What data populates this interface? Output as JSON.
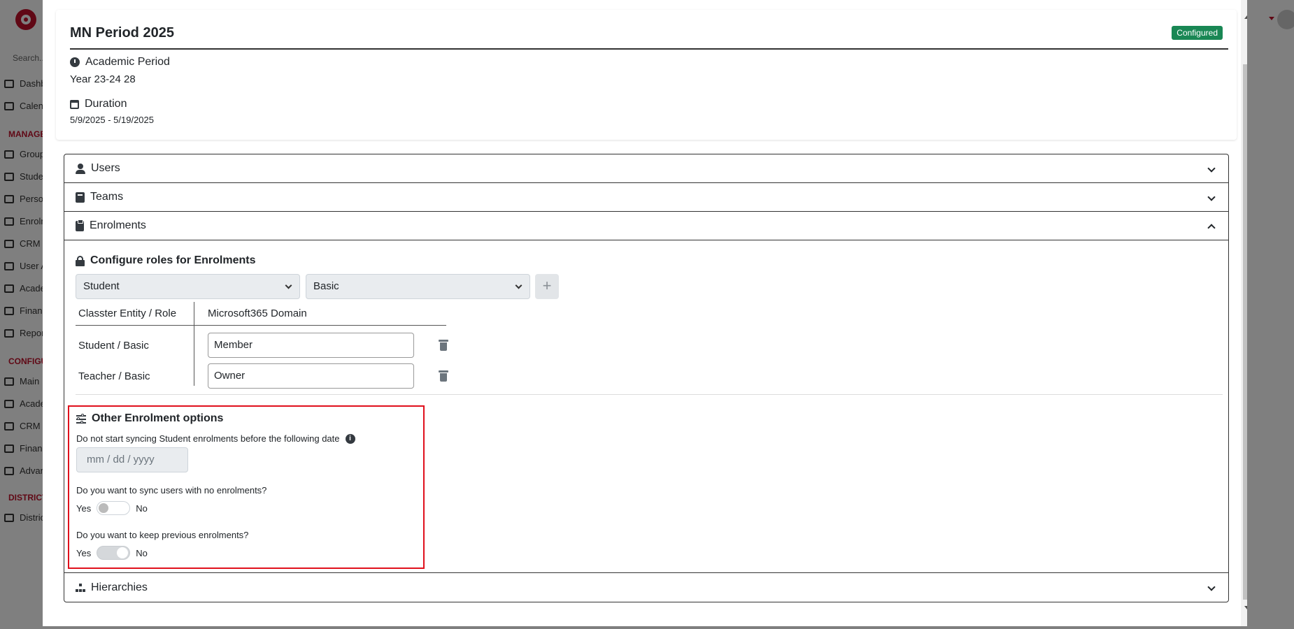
{
  "background": {
    "search_placeholder": "Search...",
    "nav": [
      {
        "label": "Dashboard",
        "icon": "laptop-icon"
      },
      {
        "label": "Calendar",
        "icon": "calendar-icon"
      }
    ],
    "section_manage": "MANAGE",
    "manage_items": [
      "Groups",
      "Students",
      "Persons",
      "Enrolments",
      "CRM",
      "User Access",
      "Academic",
      "Finance",
      "Reports"
    ],
    "section_config": "CONFIGURATION",
    "config_items": [
      "Main",
      "Academic",
      "CRM Settings",
      "Finance",
      "Advanced"
    ],
    "section_district": "DISTRICT",
    "district_items": [
      "District"
    ]
  },
  "period": {
    "title": "MN Period 2025",
    "status_badge": "Configured",
    "academic_period_label": "Academic Period",
    "academic_period_value": "Year 23-24 28",
    "duration_label": "Duration",
    "duration_value": "5/9/2025  -  5/19/2025"
  },
  "accordion": {
    "users_label": "Users",
    "teams_label": "Teams",
    "enrolments_label": "Enrolments",
    "hierarchies_label": "Hierarchies"
  },
  "enrolments": {
    "configure_title": "Configure roles for Enrolments",
    "entity_select": "Student",
    "role_select": "Basic",
    "add_button": "+",
    "table_headers": [
      "Classter Entity / Role",
      "Microsoft365 Domain"
    ],
    "rows": [
      {
        "role": "Student / Basic",
        "domain": "Member"
      },
      {
        "role": "Teacher / Basic",
        "domain": "Owner"
      }
    ],
    "other_title": "Other Enrolment options",
    "sync_date_question": "Do not start syncing Student enrolments before the following date",
    "date_placeholder": "mm / dd / yyyy",
    "sync_no_enrolments_question": "Do you want to sync users with no enrolments?",
    "keep_previous_question": "Do you want to keep previous enrolments?",
    "yes_label": "Yes",
    "no_label": "No",
    "sync_no_enrolments_toggle": "off",
    "keep_previous_toggle": "on"
  },
  "colors": {
    "badge_green": "#198754",
    "highlight_red": "#e0101c",
    "brand_red": "#c0102a"
  }
}
